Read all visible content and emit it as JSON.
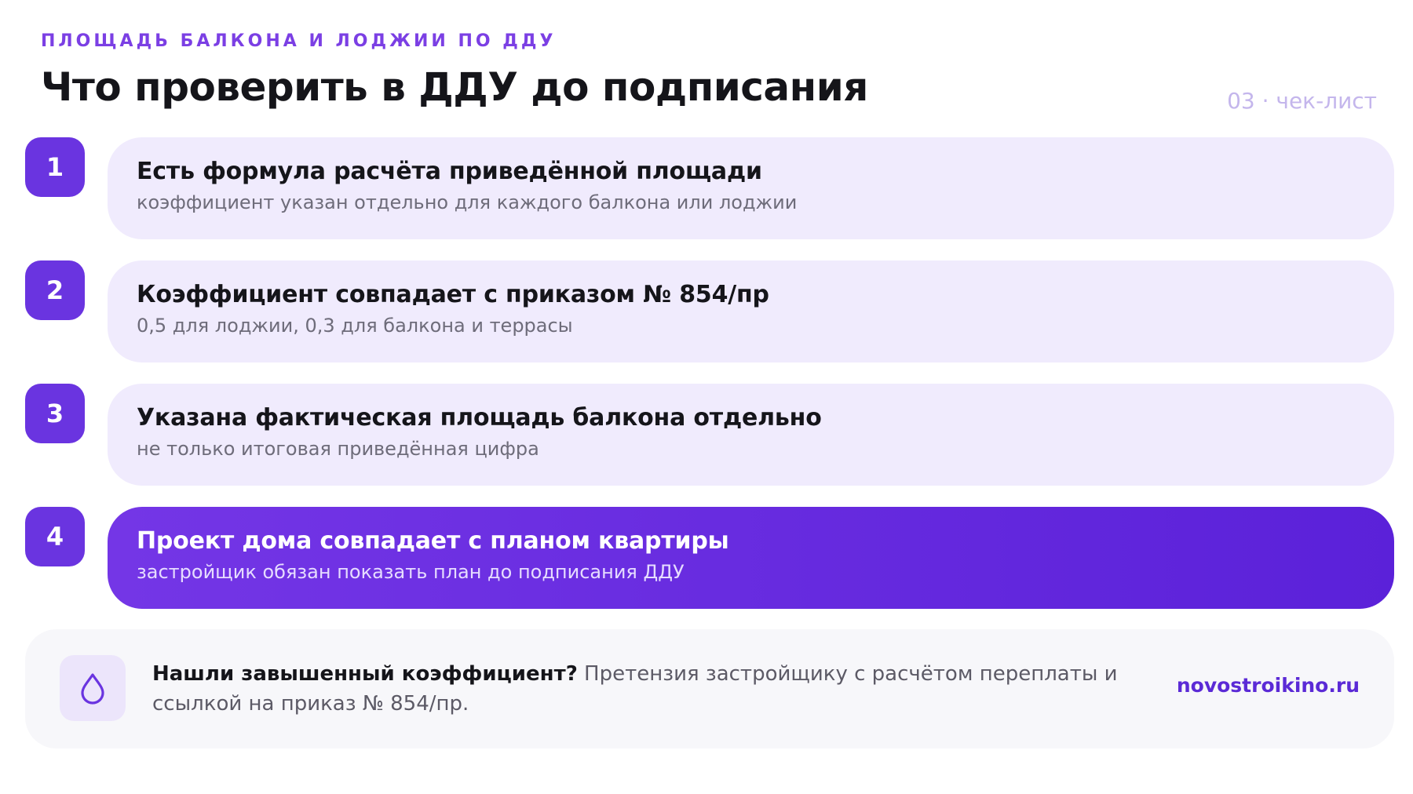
{
  "header": {
    "eyebrow": "ПЛОЩАДЬ БАЛКОНА И ЛОДЖИИ ПО ДДУ",
    "title": "Что проверить в ДДУ до подписания",
    "page_meta": "03 · чек-лист"
  },
  "checklist": {
    "items": [
      {
        "number": "1",
        "title": "Есть формула расчёта приведённой площади",
        "subtitle": "коэффициент указан отдельно для каждого балкона или лоджии",
        "highlighted": false
      },
      {
        "number": "2",
        "title": "Коэффициент совпадает с приказом № 854/пр",
        "subtitle": "0,5 для лоджии, 0,3 для балкона и террасы",
        "highlighted": false
      },
      {
        "number": "3",
        "title": "Указана фактическая площадь балкона отдельно",
        "subtitle": "не только итоговая приведённая цифра",
        "highlighted": false
      },
      {
        "number": "4",
        "title": "Проект дома совпадает с планом квартиры",
        "subtitle": "застройщик обязан показать план до подписания ДДУ",
        "highlighted": true
      }
    ]
  },
  "note": {
    "icon": "drop-icon",
    "lead": "Нашли завышенный коэффициент?",
    "text": " Претензия застройщику с расчётом переплаты и ссылкой на приказ № 854/пр.",
    "link": "novostroikino.ru"
  },
  "colors": {
    "accent": "#6a34e0",
    "card_bg": "#f0ebfd",
    "highlight_start": "#7436e6",
    "highlight_end": "#5b21d9",
    "note_bg": "#f7f7fa"
  }
}
